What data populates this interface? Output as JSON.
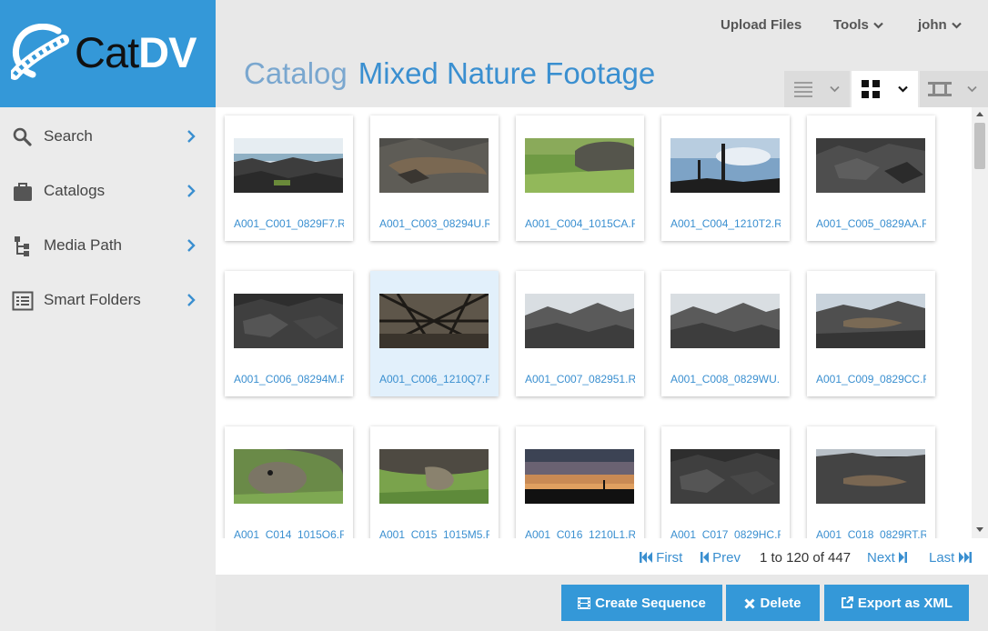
{
  "brand": {
    "name_part1": "Cat",
    "name_part2": "DV",
    "color": "#3498d8"
  },
  "sidebar": {
    "items": [
      {
        "label": "Search",
        "icon": "search-icon"
      },
      {
        "label": "Catalogs",
        "icon": "catalogs-icon"
      },
      {
        "label": "Media Path",
        "icon": "media-path-icon"
      },
      {
        "label": "Smart Folders",
        "icon": "smart-folders-icon"
      }
    ]
  },
  "header": {
    "upload_label": "Upload Files",
    "tools_label": "Tools",
    "user_label": "john",
    "title_prefix": "Catalog",
    "title": "Mixed Nature Footage"
  },
  "view_modes": [
    "list-view-icon",
    "grid-view-icon",
    "filmstrip-view-icon"
  ],
  "clips": [
    {
      "name": "A001_C001_0829F7.R",
      "thumb": "coast"
    },
    {
      "name": "A001_C003_08294U.R",
      "thumb": "iguana"
    },
    {
      "name": "A001_C004_1015CA.R",
      "thumb": "grass-tortoise"
    },
    {
      "name": "A001_C004_1210T2.R",
      "thumb": "cactus-sky"
    },
    {
      "name": "A001_C005_0829AA.R",
      "thumb": "rocks"
    },
    {
      "name": "A001_C006_08294M.R",
      "thumb": "rocks-dark"
    },
    {
      "name": "A001_C006_1210Q7.R",
      "thumb": "branches",
      "selected": true
    },
    {
      "name": "A001_C007_082951.R",
      "thumb": "rocks-sky"
    },
    {
      "name": "A001_C008_0829WU.R",
      "thumb": "rocks-sky"
    },
    {
      "name": "A001_C009_0829CC.R",
      "thumb": "iguana-sky"
    },
    {
      "name": "A001_C014_1015O6.R",
      "thumb": "tortoise-head"
    },
    {
      "name": "A001_C015_1015M5.R",
      "thumb": "tortoise-leg"
    },
    {
      "name": "A001_C016_1210L1.R",
      "thumb": "sunset"
    },
    {
      "name": "A001_C017_0829HC.R",
      "thumb": "rocks-dark"
    },
    {
      "name": "A001_C018_0829RT.R",
      "thumb": "iguana-dark"
    }
  ],
  "pager": {
    "first": "First",
    "prev": "Prev",
    "range": "1 to 120 of 447",
    "next": "Next",
    "last": "Last"
  },
  "actions": {
    "create_sequence": "Create Sequence",
    "delete": "Delete",
    "export_xml": "Export as XML"
  }
}
